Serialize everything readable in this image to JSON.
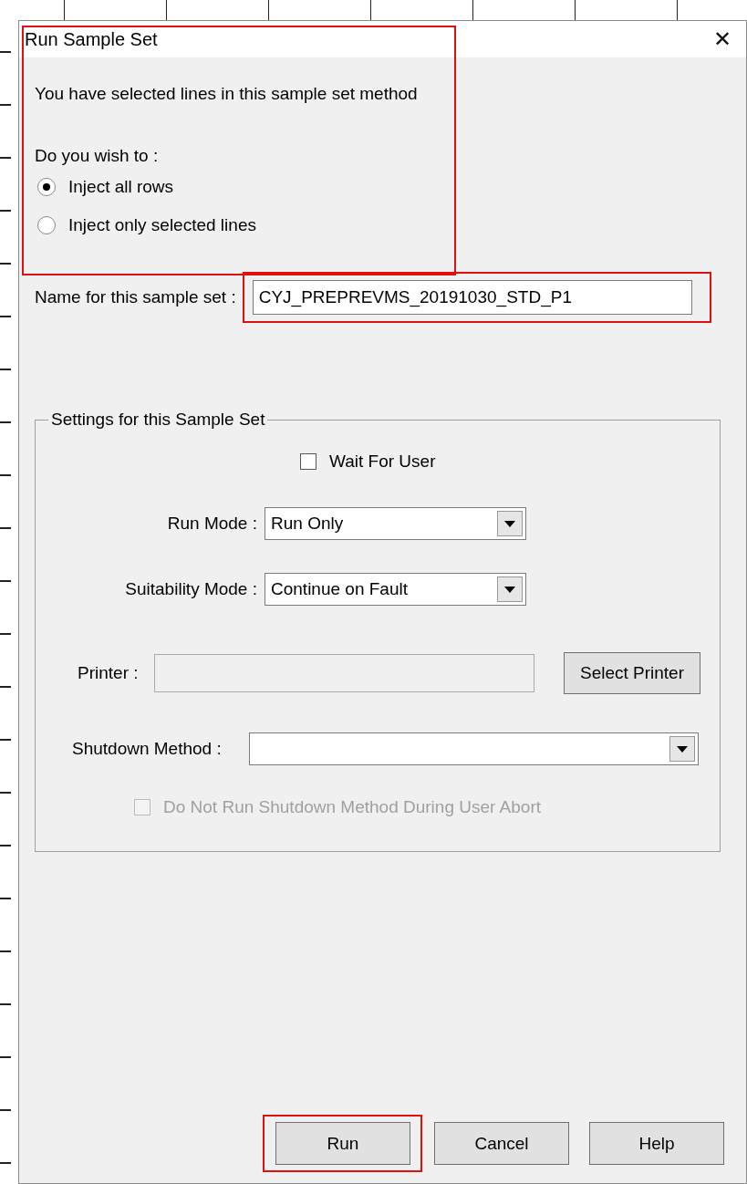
{
  "window": {
    "title": "Run Sample Set",
    "close": "✕"
  },
  "intro": {
    "highlighted": true,
    "message": "You have selected lines in this sample set method",
    "question": "Do you wish to :",
    "options": [
      {
        "label": "Inject all rows",
        "selected": true
      },
      {
        "label": "Inject only selected lines",
        "selected": false
      }
    ]
  },
  "name_field": {
    "label": "Name for this sample set :",
    "value": "CYJ_PREPREVMS_20191030_STD_P1",
    "highlighted": true
  },
  "settings": {
    "title": "Settings for this Sample Set",
    "wait_for_user": {
      "label": "Wait For User",
      "checked": false
    },
    "run_mode": {
      "label": "Run Mode :",
      "value": "Run Only"
    },
    "suitability_mode": {
      "label": "Suitability Mode :",
      "value": "Continue on Fault"
    },
    "printer": {
      "label": "Printer :",
      "disabled": true,
      "button": "Select Printer"
    },
    "shutdown_method": {
      "label": "Shutdown Method :"
    },
    "no_shutdown_on_abort": {
      "label": "Do Not Run Shutdown Method During User Abort",
      "checked": false,
      "disabled": true
    }
  },
  "buttons": [
    {
      "label": "Run",
      "highlighted": true
    },
    {
      "label": "Cancel",
      "highlighted": false
    },
    {
      "label": "Help",
      "highlighted": false
    }
  ]
}
